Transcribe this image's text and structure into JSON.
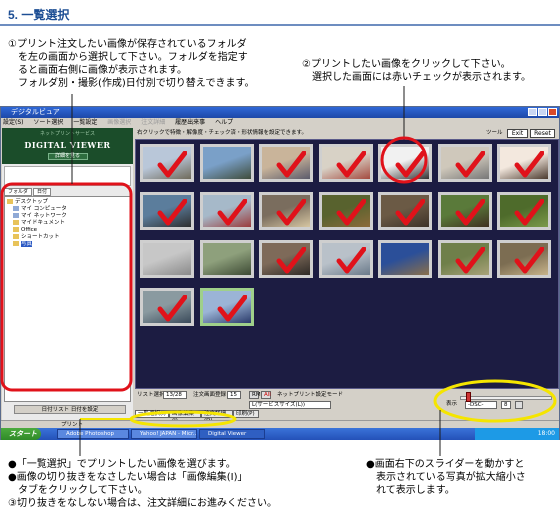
{
  "heading": "5. 一覧選択",
  "callouts": {
    "c1": "①プリント注文したい画像が保存されているフォルダ\n　を左の画面から選択して下さい。フォルダを指定す\n　ると画面右側に画像が表示されます。\n　フォルダ別・撮影(作成)日付別で切り替えできます。",
    "c2": "②プリントしたい画像をクリックして下さい。\n　選択した画面には赤いチェックが表示されます。",
    "b1": "●「一覧選択」でプリントしたい画像を選びます。\n●画像の切り抜きをなさしたい場合は「画像編集(I)」\n　タブをクリックして下さい。\n③切り抜きをなしない場合は、注文詳細にお進みください。",
    "b2": "●画面右下のスライダーを動かすと\n　表示されている写真が拡大縮小さ\n　れて表示します。"
  },
  "app": {
    "window_title": "デジタルビュア",
    "menu": [
      "設定(S)",
      "ソート選択",
      "一覧設定",
      "画像選択",
      "注文詳細",
      "履歴出来事",
      "ヘルプ"
    ],
    "left": {
      "logo_sub": "ネットプリントサービス",
      "logo_title": "DIGITAL VIEWER",
      "logo_btn": "詳細を見る",
      "tabs": [
        "フォルダ",
        "日付"
      ],
      "tree": [
        {
          "label": "デスクトップ",
          "indent": 0
        },
        {
          "label": "マイ コンピュータ",
          "indent": 1
        },
        {
          "label": "マイ ネットワーク",
          "indent": 1
        },
        {
          "label": "マイドキュメント",
          "indent": 1
        },
        {
          "label": "Office",
          "indent": 1
        },
        {
          "label": "ショートカット",
          "indent": 1
        },
        {
          "label": "写真",
          "indent": 1,
          "selected": true
        }
      ],
      "date_button": "日付リスト 日付を設定"
    },
    "right": {
      "info": "右クリックで特徴・解像度・チェック済・形状情報を設定できます。",
      "tool_label": "ツール",
      "exit": "Exit",
      "reset": "Reset"
    },
    "bottom": {
      "count_label": "リスト選択",
      "count_value": "13/28",
      "order_label": "注文画面登録",
      "order_value": "15",
      "rm": "RM",
      "all": "All",
      "mode_label": "ネットプリント設定モード",
      "print_select": "L(サービスサイズ(L))",
      "zoom_label": "表示",
      "zoom_select": "-DSC-",
      "zoom_value": "8",
      "tabs": [
        "一覧選択(I)",
        "画像編集(I)",
        "注文詳細(D)",
        "印刷(P)"
      ]
    },
    "status": "プリント",
    "taskbar": {
      "start": "スタート",
      "tasks": [
        "Adobe Photoshop",
        "Yahoo! JAPAN - Micr...",
        "Digital Viewer"
      ],
      "clock": "18:00"
    }
  },
  "accent": {
    "red": "#e0121a",
    "yellow": "#f5e500",
    "blue_bar": "#2b59c3"
  },
  "thumbnails": [
    {
      "checked": true,
      "highlight": false
    },
    {
      "checked": false,
      "highlight": false
    },
    {
      "checked": true,
      "highlight": false
    },
    {
      "checked": true,
      "highlight": false
    },
    {
      "checked": true,
      "highlight": true
    },
    {
      "checked": true,
      "highlight": false
    },
    {
      "checked": true,
      "highlight": false
    },
    {
      "checked": true,
      "highlight": false
    },
    {
      "checked": true,
      "highlight": false
    },
    {
      "checked": true,
      "highlight": false
    },
    {
      "checked": true,
      "highlight": false
    },
    {
      "checked": true,
      "highlight": false
    },
    {
      "checked": true,
      "highlight": false
    },
    {
      "checked": true,
      "highlight": false
    },
    {
      "checked": false,
      "highlight": false
    },
    {
      "checked": false,
      "highlight": false
    },
    {
      "checked": true,
      "highlight": false
    },
    {
      "checked": true,
      "highlight": false
    },
    {
      "checked": false,
      "highlight": false
    },
    {
      "checked": true,
      "highlight": false
    },
    {
      "checked": true,
      "highlight": false
    },
    {
      "checked": true,
      "highlight": false
    },
    {
      "checked": true,
      "highlight": false
    }
  ]
}
